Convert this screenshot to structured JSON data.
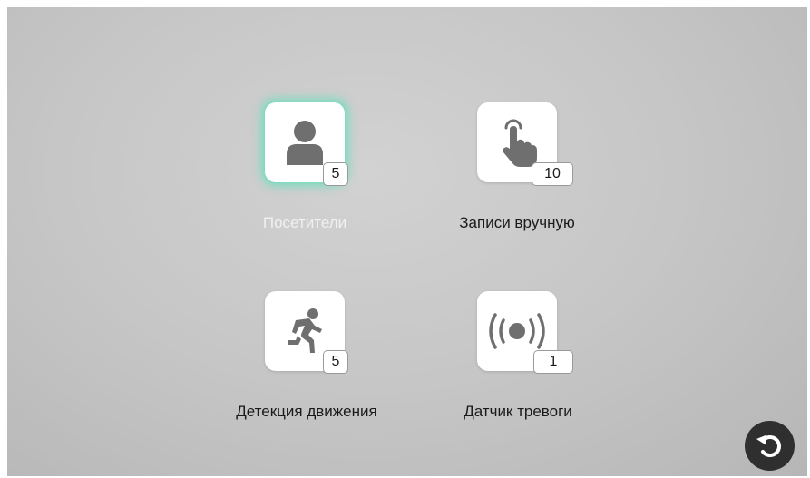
{
  "tiles": [
    {
      "label": "Посетители",
      "count": "5",
      "icon": "person-icon",
      "selected": true
    },
    {
      "label": "Записи вручную",
      "count": "10",
      "icon": "hand-tap-icon",
      "selected": false
    },
    {
      "label": "Детекция движения",
      "count": "5",
      "icon": "running-man-icon",
      "selected": false
    },
    {
      "label": "Датчик тревоги",
      "count": "1",
      "icon": "alarm-signal-icon",
      "selected": false
    }
  ],
  "back_button": {
    "icon": "back-arrow-icon"
  },
  "colors": {
    "selection_glow": "#78dcbe",
    "icon_gray": "#6f6f6f",
    "back_button_bg": "#2f2f2f"
  }
}
